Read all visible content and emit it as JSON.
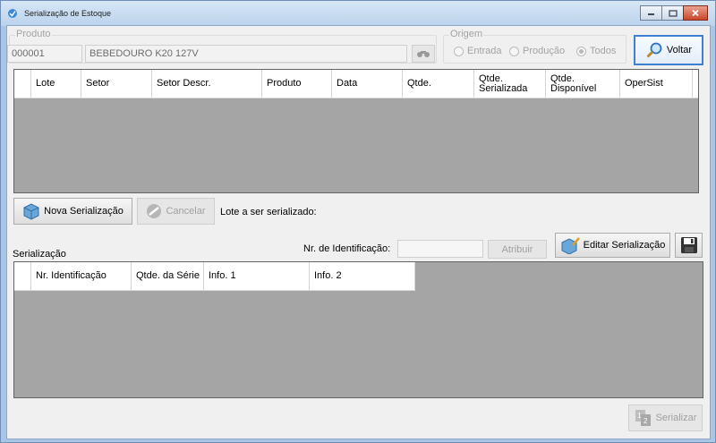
{
  "window": {
    "title": "Serialização de Estoque"
  },
  "produto": {
    "group_label": "Produto",
    "code": "000001",
    "description": "BEBEDOURO K20 127V"
  },
  "origem": {
    "group_label": "Origem",
    "options": [
      "Entrada",
      "Produção",
      "Todos"
    ],
    "selected": "Todos"
  },
  "buttons": {
    "voltar": "Voltar",
    "nova_serializacao": "Nova Serialização",
    "cancelar": "Cancelar",
    "atribuir": "Atribuir",
    "editar_serializacao": "Editar Serialização",
    "serializar": "Serializar"
  },
  "lotes_grid": {
    "columns": [
      "Lote",
      "Setor",
      "Setor Descr.",
      "Produto",
      "Data",
      "Qtde.",
      "Qtde. Serializada",
      "Qtde. Disponível",
      "OperSist"
    ]
  },
  "lote_label": "Lote a ser serializado:",
  "serializacao": {
    "section_label": "Serialização",
    "nr_identificacao_label": "Nr. de Identificação:",
    "nr_identificacao_value": "",
    "columns": [
      "Nr. Identificação",
      "Qtde. da Série",
      "Info. 1",
      "Info. 2"
    ]
  }
}
